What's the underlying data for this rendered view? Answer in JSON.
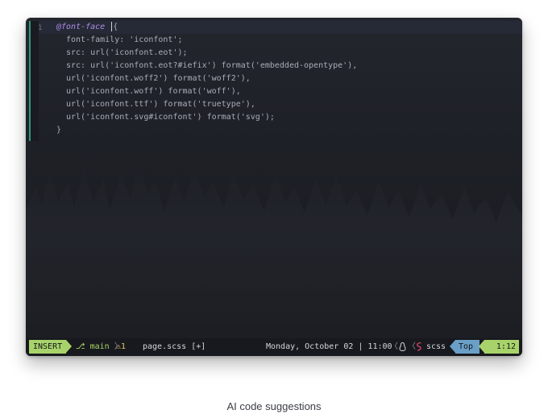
{
  "editor": {
    "line_number": "1",
    "lines": [
      "font-family: 'iconfont';",
      "src: url('iconfont.eot');",
      "src: url('iconfont.eot?#iefix') format('embedded-opentype'),",
      "url('iconfont.woff2') format('woff2'),",
      "url('iconfont.woff') format('woff'),",
      "url('iconfont.ttf') format('truetype'),",
      "url('iconfont.svg#iconfont') format('svg');",
      "}"
    ],
    "keyword": "@font-face",
    "open_brace": "{"
  },
  "statusline": {
    "mode": "INSERT",
    "branch_icon": "⎇",
    "branch": "main",
    "warning_icon": "⚠",
    "warning_count": "1",
    "file": "page.scss [+]",
    "datetime": "Monday, October 02 | 11:00",
    "os_icon": "linux-icon",
    "filetype_icon": "sass-icon",
    "filetype": "scss",
    "scroll": "Top",
    "position": "1:12"
  },
  "caption": "AI code suggestions",
  "colors": {
    "accent_green": "#a8d36a",
    "accent_blue": "#6a9fc8",
    "keyword_purple": "#b08ce8",
    "sass_pink": "#e34c6b",
    "warning_yellow": "#e6c468"
  }
}
